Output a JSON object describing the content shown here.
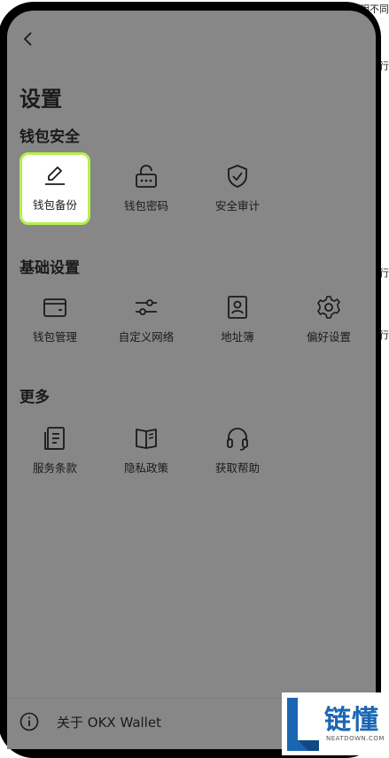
{
  "edge_text": [
    "明不同",
    "行",
    "行",
    "行"
  ],
  "page": {
    "title": "设置"
  },
  "sections": [
    {
      "title": "钱包安全",
      "items": [
        {
          "label": "钱包备份",
          "icon": "pen-icon",
          "highlighted": true
        },
        {
          "label": "钱包密码",
          "icon": "lock-password-icon",
          "highlighted": false
        },
        {
          "label": "安全审计",
          "icon": "shield-check-icon",
          "highlighted": false
        }
      ]
    },
    {
      "title": "基础设置",
      "items": [
        {
          "label": "钱包管理",
          "icon": "wallet-icon"
        },
        {
          "label": "自定义网络",
          "icon": "sliders-icon"
        },
        {
          "label": "地址簿",
          "icon": "address-book-icon"
        },
        {
          "label": "偏好设置",
          "icon": "gear-icon"
        }
      ]
    },
    {
      "title": "更多",
      "items": [
        {
          "label": "服务条款",
          "icon": "terms-document-icon"
        },
        {
          "label": "隐私政策",
          "icon": "privacy-book-icon"
        },
        {
          "label": "获取帮助",
          "icon": "headset-icon"
        }
      ]
    }
  ],
  "footer": {
    "about_label": "关于 OKX Wallet",
    "icon": "info-icon"
  },
  "watermark": {
    "title": "链懂",
    "subtitle": "NEATDOWN.COM"
  },
  "colors": {
    "overlay": "#878787",
    "highlight_border": "#b4f04d",
    "watermark_blue": "#1a66b3"
  }
}
